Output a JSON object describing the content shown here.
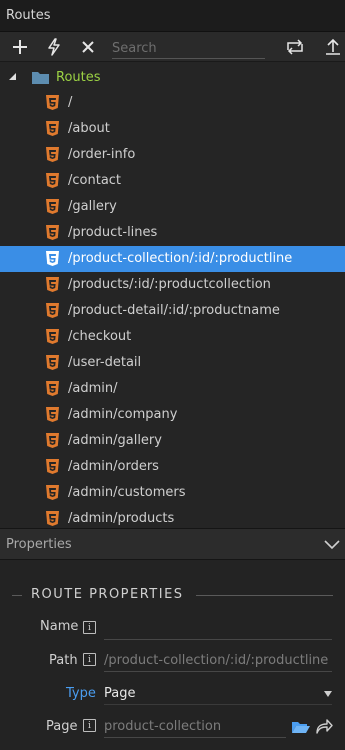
{
  "panel": {
    "title": "Routes"
  },
  "toolbar": {
    "search_placeholder": "Search",
    "buttons": [
      "plus-icon",
      "lightning-icon",
      "close-icon",
      "convert-icon",
      "upload-icon"
    ]
  },
  "tree": {
    "root_label": "Routes",
    "routes": [
      "/",
      "/about",
      "/order-info",
      "/contact",
      "/gallery",
      "/product-lines",
      "/product-collection/:id/:productline",
      "/products/:id/:productcollection",
      "/product-detail/:id/:productname",
      "/checkout",
      "/user-detail",
      "/admin/",
      "/admin/company",
      "/admin/gallery",
      "/admin/orders",
      "/admin/customers",
      "/admin/products"
    ],
    "selected_index": 6
  },
  "properties": {
    "header": "Properties",
    "section_title": "ROUTE PROPERTIES",
    "name_label": "Name",
    "name_value": "",
    "path_label": "Path",
    "path_value": "/product-collection/:id/:productline",
    "type_label": "Type",
    "type_value": "Page",
    "page_label": "Page",
    "page_value": "product-collection"
  },
  "colors": {
    "selected_row": "#3a8ee6",
    "root_label": "#9bd144",
    "type_label": "#4a9df0",
    "html5_icon": "#e07a2e"
  }
}
